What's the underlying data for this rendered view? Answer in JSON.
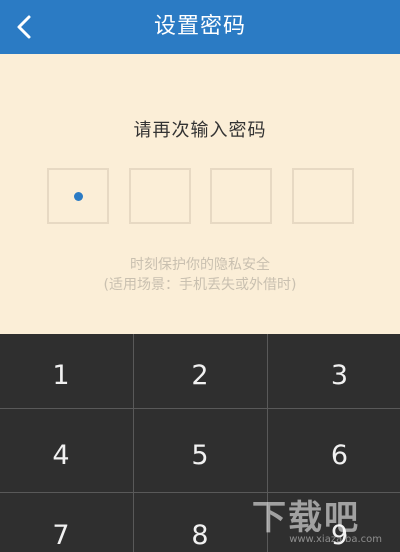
{
  "header": {
    "title": "设置密码",
    "back_icon": "chevron-left-icon"
  },
  "main": {
    "prompt": "请再次输入密码",
    "pin": {
      "length": 4,
      "filled": 1
    },
    "hint_line1": "时刻保护你的隐私安全",
    "hint_line2": "(适用场景：手机丢失或外借时)"
  },
  "keypad": {
    "keys": [
      "1",
      "2",
      "3",
      "4",
      "5",
      "6",
      "7",
      "8",
      "9"
    ]
  },
  "watermark": {
    "main": "下载吧",
    "sub": "www.xiazaiba.com"
  },
  "colors": {
    "header_bg": "#2b7bc4",
    "content_bg": "#fbeed7",
    "keypad_bg": "#2f2f2f",
    "pin_dot": "#2b7bc4"
  }
}
